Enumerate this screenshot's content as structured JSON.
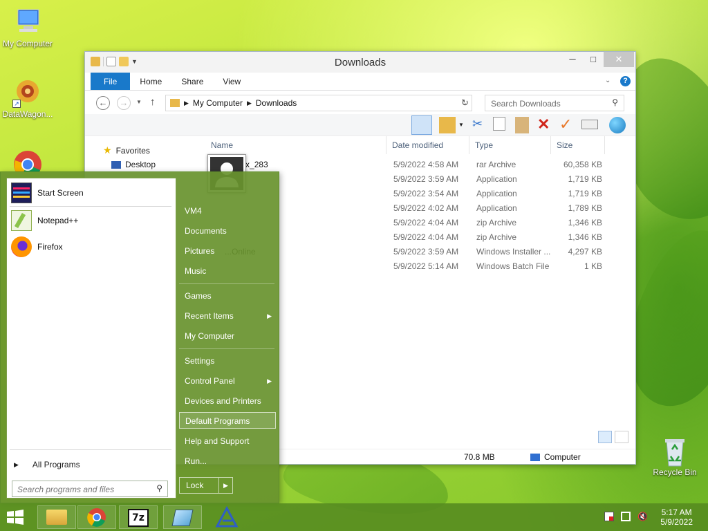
{
  "desktop": {
    "icons": [
      {
        "label": "My Computer",
        "icon": "computer-icon"
      },
      {
        "label": "DataWagon...",
        "icon": "datawagon-icon"
      },
      {
        "label": "Recycle Bin",
        "icon": "recycle-bin-icon"
      }
    ]
  },
  "explorer": {
    "title": "Downloads",
    "tabs": [
      "File",
      "Home",
      "Share",
      "View"
    ],
    "breadcrumb": [
      "My Computer",
      "Downloads"
    ],
    "search_placeholder": "Search Downloads",
    "columns": [
      "Name",
      "Date modified",
      "Type",
      "Size"
    ],
    "nav": {
      "favorites": "Favorites",
      "desktop": "Desktop"
    },
    "files": [
      {
        "name": "...nbox_283",
        "date": "5/9/2022 4:58 AM",
        "type": "rar Archive",
        "size": "60,358 KB"
      },
      {
        "name": "",
        "date": "5/9/2022 3:59 AM",
        "type": "Application",
        "size": "1,719 KB"
      },
      {
        "name": "",
        "date": "5/9/2022 3:54 AM",
        "type": "Application",
        "size": "1,719 KB"
      },
      {
        "name": "",
        "date": "5/9/2022 4:02 AM",
        "type": "Application",
        "size": "1,789 KB"
      },
      {
        "name": "",
        "date": "5/9/2022 4:04 AM",
        "type": "zip Archive",
        "size": "1,346 KB"
      },
      {
        "name": "",
        "date": "5/9/2022 4:04 AM",
        "type": "zip Archive",
        "size": "1,346 KB"
      },
      {
        "name": "...Online",
        "date": "5/9/2022 3:59 AM",
        "type": "Windows Installer ...",
        "size": "4,297 KB"
      },
      {
        "name": "",
        "date": "5/9/2022 5:14 AM",
        "type": "Windows Batch File",
        "size": "1 KB"
      }
    ],
    "status": {
      "size": "70.8 MB",
      "location": "Computer"
    }
  },
  "start_menu": {
    "pinned": [
      {
        "label": "Start Screen",
        "icon": "start-screen-icon"
      },
      {
        "label": "Notepad++",
        "icon": "notepadpp-icon"
      },
      {
        "label": "Firefox",
        "icon": "firefox-icon"
      }
    ],
    "all_programs": "All Programs",
    "search_placeholder": "Search programs and files",
    "right": {
      "user": "VM4",
      "documents": "Documents",
      "pictures": "Pictures",
      "music": "Music",
      "games": "Games",
      "recent": "Recent Items",
      "computer": "My Computer",
      "settings": "Settings",
      "control_panel": "Control Panel",
      "devices": "Devices and Printers",
      "default_programs": "Default Programs",
      "help": "Help and Support",
      "run": "Run..."
    },
    "lock": "Lock"
  },
  "taskbar": {
    "apps": [
      "file-explorer-icon",
      "chrome-icon",
      "7zip-icon",
      "notes-icon",
      "triangle-app-icon"
    ],
    "time": "5:17 AM",
    "date": "5/9/2022"
  }
}
